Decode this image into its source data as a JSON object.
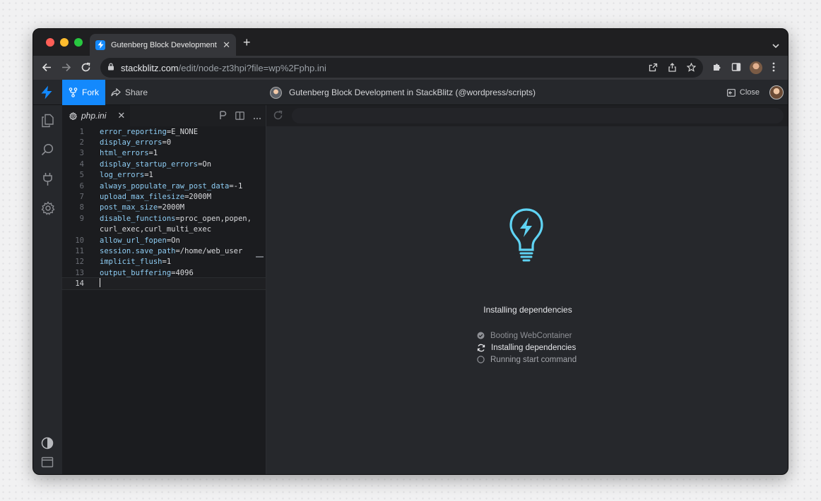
{
  "browser": {
    "tab_title": "Gutenberg Block Development",
    "url_host": "stackblitz.com",
    "url_path": "/edit/node-zt3hpi?file=wp%2Fphp.ini",
    "traffic_lights": [
      "#ff5f57",
      "#febc2e",
      "#28c840"
    ]
  },
  "topbar": {
    "fork_label": "Fork",
    "share_label": "Share",
    "project_title": "Gutenberg Block Development in StackBlitz (@wordpress/scripts)",
    "close_label": "Close"
  },
  "editor": {
    "file_name": "php.ini",
    "lines": [
      {
        "num": "1",
        "key": "error_reporting",
        "val": "=E_NONE"
      },
      {
        "num": "2",
        "key": "display_errors",
        "val": "=0"
      },
      {
        "num": "3",
        "key": "html_errors",
        "val": "=1"
      },
      {
        "num": "4",
        "key": "display_startup_errors",
        "val": "=On"
      },
      {
        "num": "5",
        "key": "log_errors",
        "val": "=1"
      },
      {
        "num": "6",
        "key": "always_populate_raw_post_data",
        "val": "=-1"
      },
      {
        "num": "7",
        "key": "upload_max_filesize",
        "val": "=2000M"
      },
      {
        "num": "8",
        "key": "post_max_size",
        "val": "=2000M"
      },
      {
        "num": "9",
        "key": "disable_functions",
        "val": "=proc_open,popen,"
      },
      {
        "num": "",
        "key": "",
        "val": "curl_exec,curl_multi_exec"
      },
      {
        "num": "10",
        "key": "allow_url_fopen",
        "val": "=On"
      },
      {
        "num": "11",
        "key": "session.save_path",
        "val": "=/home/web_user"
      },
      {
        "num": "12",
        "key": "implicit_flush",
        "val": "=1"
      },
      {
        "num": "13",
        "key": "output_buffering",
        "val": "=4096"
      },
      {
        "num": "14",
        "key": "",
        "val": ""
      }
    ]
  },
  "preview": {
    "status_title": "Installing dependencies",
    "steps": [
      {
        "label": "Booting WebContainer",
        "state": "done"
      },
      {
        "label": "Installing dependencies",
        "state": "active"
      },
      {
        "label": "Running start command",
        "state": "pending"
      }
    ]
  },
  "colors": {
    "accent": "#1389fd",
    "bulb": "#5fd3f3",
    "key": "#8ecdf4"
  },
  "icons": {
    "activity": [
      "files-icon",
      "search-icon",
      "plug-icon",
      "settings-icon",
      "theme-toggle-icon",
      "layout-icon"
    ]
  }
}
